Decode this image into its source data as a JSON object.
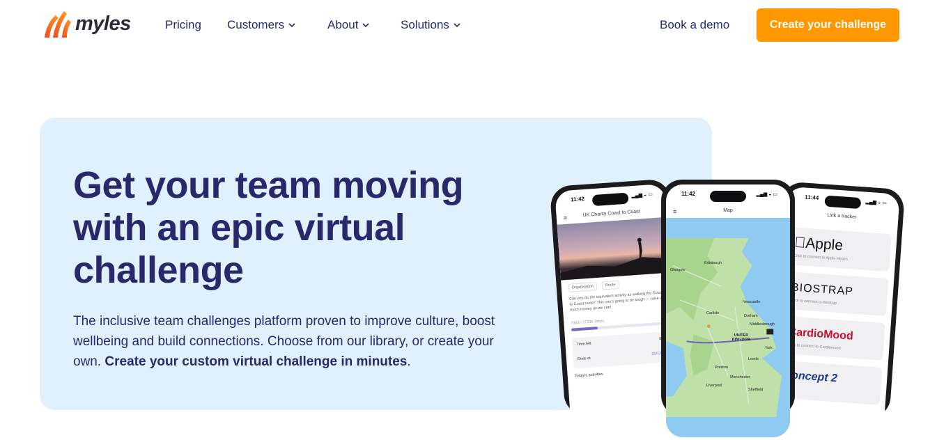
{
  "brand": {
    "name": "myles",
    "color_primary": "#ff9800",
    "color_text": "#28286b"
  },
  "nav": {
    "items": [
      {
        "label": "Pricing",
        "has_dropdown": false
      },
      {
        "label": "Customers",
        "has_dropdown": true
      },
      {
        "label": "About",
        "has_dropdown": true
      },
      {
        "label": "Solutions",
        "has_dropdown": true
      }
    ],
    "book_demo": "Book a demo",
    "cta": "Create your challenge"
  },
  "hero": {
    "headline": "Get your team moving with an epic virtual challenge",
    "subtitle_part1": "The inclusive team challenges platform proven to improve culture, boost wellbeing and build connections. Choose from our library, or create your own.",
    "subtitle_bold": "Create your custom virtual challenge in minutes",
    "subtitle_end": "."
  },
  "phones": {
    "left": {
      "time": "11:42",
      "title": "UK Charity Coast to Coast",
      "tag1": "Organisation",
      "tag2": "Route",
      "desc": "Can you do the equivalent activity as walking the Coast to Coast route? This one's going to be tough — raise as much money as we can!",
      "progress_text": "7343 / 27336 Steps",
      "time_left_label": "Time left",
      "time_left_value": "8 m",
      "ends_label": "Ends at",
      "ends_value": "31/12/20",
      "activities_label": "Today's activities"
    },
    "middle": {
      "time": "11:42",
      "title": "Map",
      "places": [
        "Edinburgh",
        "Glasgow",
        "Newcastle",
        "Carlisle",
        "UNITED KINGDOM",
        "Leeds",
        "Manchester",
        "Liverpool",
        "Sheffield",
        "Middlesbrough",
        "York",
        "Preston",
        "Durham"
      ]
    },
    "right": {
      "time": "11:44",
      "title": "Link a tracker",
      "trackers": [
        {
          "name": "Apple",
          "sub": "Click to connect to Apple Health"
        },
        {
          "name": "BIOSTRAP",
          "sub": "Click to connect to Biostrap"
        },
        {
          "name": "CardioMood",
          "sub": "Click to connect to Cardiomood"
        },
        {
          "name": "concept 2",
          "sub": ""
        }
      ]
    }
  }
}
